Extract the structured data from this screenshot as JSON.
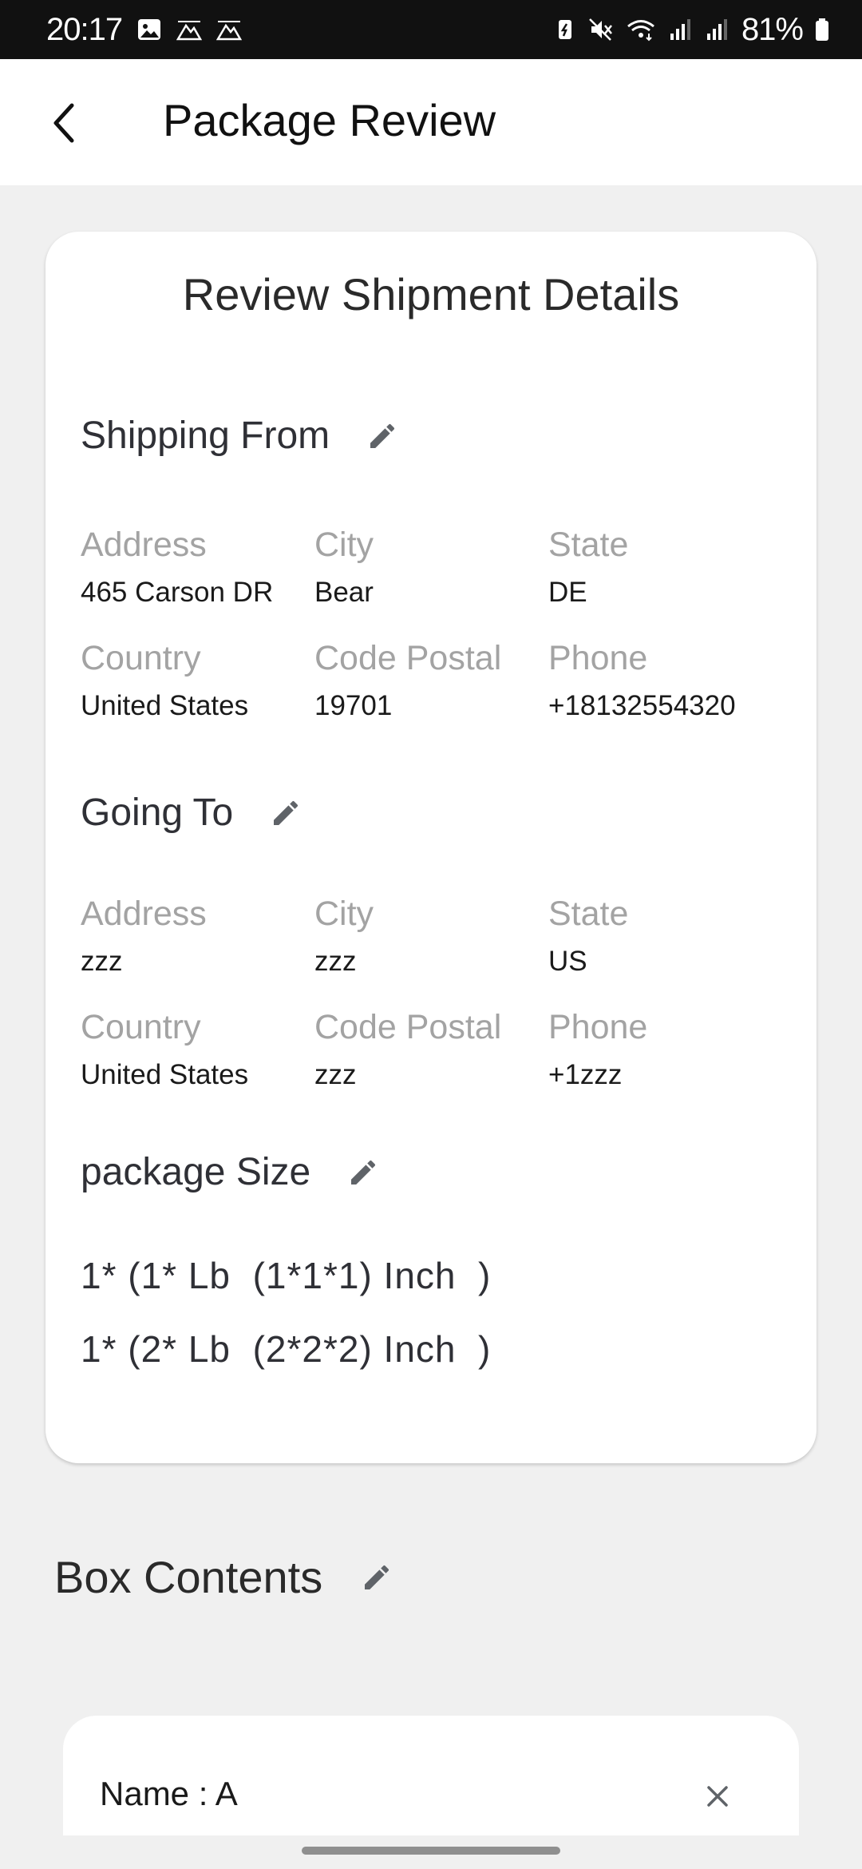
{
  "status_bar": {
    "time": "20:17",
    "battery": "81%",
    "icons": [
      "gallery-icon",
      "mountain-icon",
      "mountain-icon",
      "battery-saver-icon",
      "mute-icon",
      "wifi-icon",
      "signal-icon",
      "signal-icon",
      "battery-icon"
    ]
  },
  "app_bar": {
    "title": "Package Review",
    "back_icon": "back-arrow-icon"
  },
  "card": {
    "title": "Review Shipment Details",
    "shipping_from": {
      "heading": "Shipping From",
      "address_label": "Address",
      "address": "465 Carson DR",
      "city_label": "City",
      "city": "Bear",
      "state_label": "State",
      "state": "DE",
      "country_label": "Country",
      "country": "United States",
      "postal_label": "Code Postal",
      "postal": "19701",
      "phone_label": "Phone",
      "phone": "+18132554320"
    },
    "going_to": {
      "heading": "Going To",
      "address_label": "Address",
      "address": "zzz",
      "city_label": "City",
      "city": "zzz",
      "state_label": "State",
      "state": "US",
      "country_label": "Country",
      "country": "United States",
      "postal_label": "Code Postal",
      "postal": "zzz",
      "phone_label": "Phone",
      "phone": "+1zzz"
    },
    "package_size": {
      "heading": "package Size",
      "lines": [
        "1* (1* Lb  (1*1*1) Inch  )",
        "1* (2* Lb  (2*2*2) Inch  )"
      ]
    }
  },
  "box_contents": {
    "heading": "Box Contents",
    "items": [
      {
        "name": "Name : A"
      }
    ]
  },
  "colors": {
    "status_bar": "#111111",
    "background": "#f0f0f0",
    "card": "#ffffff",
    "label_gray": "#a3a3a3",
    "edit_icon": "#5f6368"
  }
}
